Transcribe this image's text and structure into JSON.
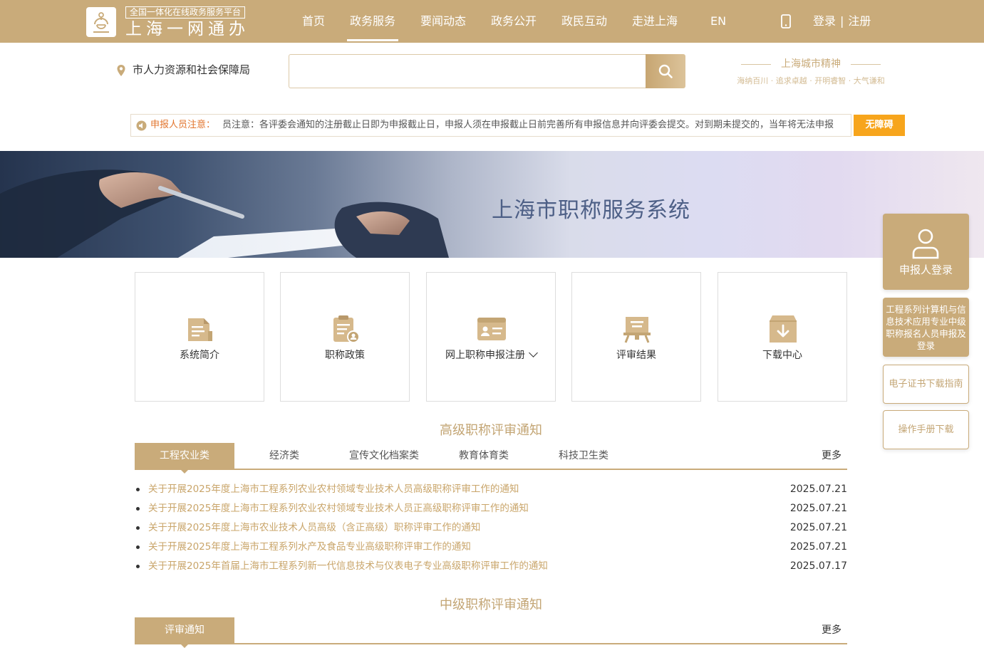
{
  "header": {
    "logo_tag": "全国一体化在线政务服务平台",
    "logo_title": "上海一网通办",
    "nav": [
      "首页",
      "政务服务",
      "要闻动态",
      "政务公开",
      "政民互动",
      "走进上海",
      "EN"
    ],
    "active_nav": "政务服务",
    "login": "登录",
    "register": "注册",
    "separator": "|"
  },
  "search": {
    "location": "市人力资源和社会保障局",
    "placeholder": ""
  },
  "city_spirit": {
    "title": "上海城市精神",
    "subtitle": "海纳百川 · 追求卓越 · 开明睿智 · 大气谦和"
  },
  "notice": {
    "label": "申报人员注意：",
    "text": "员注意：各评委会通知的注册截止日即为申报截止日，申报人须在申报截止日前完善所有申报信息并向评委会提交。对到期未提交的，当年将无法申报",
    "accessibility_button": "无障碍"
  },
  "banner": {
    "title": "上海市职称服务系统"
  },
  "cards": [
    {
      "label": "系统简介",
      "icon": "document-icon"
    },
    {
      "label": "职称政策",
      "icon": "clipboard-policy-icon"
    },
    {
      "label": "网上职称申报注册",
      "icon": "id-card-icon"
    },
    {
      "label": "评审结果",
      "icon": "podium-icon"
    },
    {
      "label": "下载中心",
      "icon": "download-box-icon"
    }
  ],
  "senior": {
    "title": "高级职称评审通知",
    "tabs": [
      "工程农业类",
      "经济类",
      "宣传文化档案类",
      "教育体育类",
      "科技卫生类"
    ],
    "more": "更多",
    "news": [
      {
        "title": "关于开展2025年度上海市工程系列农业农村领域专业技术人员高级职称评审工作的通知",
        "date": "2025.07.21"
      },
      {
        "title": "关于开展2025年度上海市工程系列农业农村领域专业技术人员正高级职称评审工作的通知",
        "date": "2025.07.21"
      },
      {
        "title": "关于开展2025年度上海市农业技术人员高级（含正高级）职称评审工作的通知",
        "date": "2025.07.21"
      },
      {
        "title": "关于开展2025年度上海市工程系列水产及食品专业高级职称评审工作的通知",
        "date": "2025.07.21"
      },
      {
        "title": "关于开展2025年首届上海市工程系列新一代信息技术与仪表电子专业高级职称评审工作的通知",
        "date": "2025.07.17"
      }
    ]
  },
  "intermediate": {
    "title": "中级职称评审通知",
    "tabs": [
      "评审通知"
    ],
    "more": "更多"
  },
  "side": {
    "login": "申报人登录",
    "engineering": "工程系列计算机与信息技术应用专业中级职称报名人员申报及登录",
    "cert_guide": "电子证书下载指南",
    "manual": "操作手册下载"
  },
  "colors": {
    "gold": "#c9ab7a",
    "link": "#c9a56a",
    "notice_label": "#e2752e",
    "accessibility": "#f7a51c",
    "banner_title": "#4d5f86"
  }
}
